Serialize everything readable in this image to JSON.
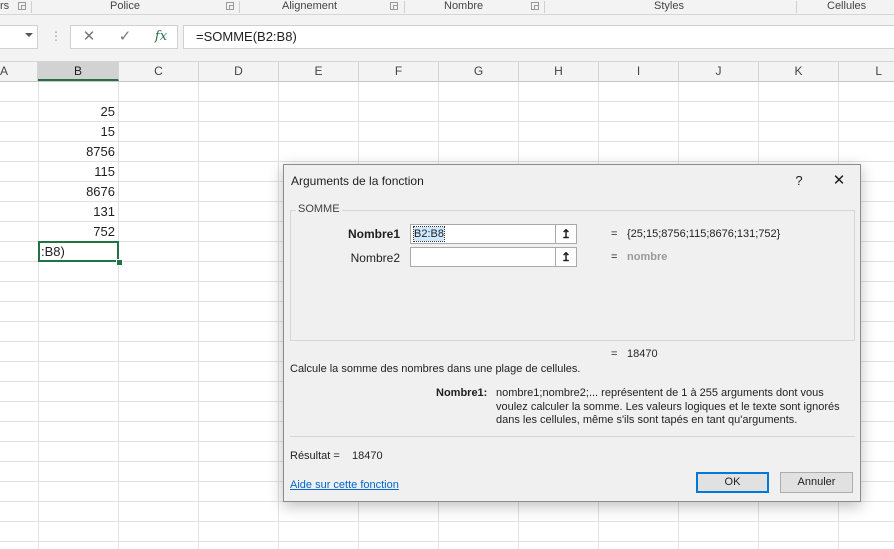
{
  "ribbon": {
    "groups": [
      {
        "label": "rs"
      },
      {
        "label": "Police"
      },
      {
        "label": "Alignement"
      },
      {
        "label": "Nombre"
      },
      {
        "label": "Styles"
      },
      {
        "label": "Cellules"
      }
    ]
  },
  "formula_bar": {
    "name_box": "",
    "dots": "⋮",
    "cancel_icon": "✕",
    "enter_icon": "✓",
    "fx_icon": "fx",
    "formula": "=SOMME(B2:B8)"
  },
  "grid": {
    "columns": [
      "A",
      "B",
      "C",
      "D",
      "E",
      "F",
      "G",
      "H",
      "I",
      "J",
      "K",
      "L"
    ],
    "selected_column": "B",
    "column_b_values": [
      "25",
      "15",
      "8756",
      "115",
      "8676",
      "131",
      "752"
    ],
    "active_cell_text": ":B8)"
  },
  "dialog": {
    "title": "Arguments de la fonction",
    "help_button": "?",
    "close_button": "✕",
    "function_name": "SOMME",
    "args": [
      {
        "label": "Nombre1",
        "value": "B2:B8",
        "collapse_icon": "↥",
        "equals": "=",
        "result": "{25;15;8756;115;8676;131;752}"
      },
      {
        "label": "Nombre2",
        "value": "",
        "collapse_icon": "↥",
        "equals": "=",
        "result": "nombre"
      }
    ],
    "total_equals": "=",
    "total_value": "18470",
    "description": "Calcule la somme des nombres dans une plage de cellules.",
    "arg_description_label": "Nombre1:",
    "arg_description_text": "nombre1;nombre2;... représentent de 1 à 255 arguments dont vous voulez calculer la somme. Les valeurs logiques et le texte sont ignorés dans les cellules, même s'ils sont tapés en tant qu'arguments.",
    "result_label": "Résultat =",
    "result_value": "18470",
    "help_link": "Aide sur cette fonction",
    "ok_button": "OK",
    "cancel_button": "Annuler"
  },
  "colors": {
    "excel_green": "#217346",
    "link_blue": "#0066cc",
    "focus_blue": "#0078d7"
  }
}
